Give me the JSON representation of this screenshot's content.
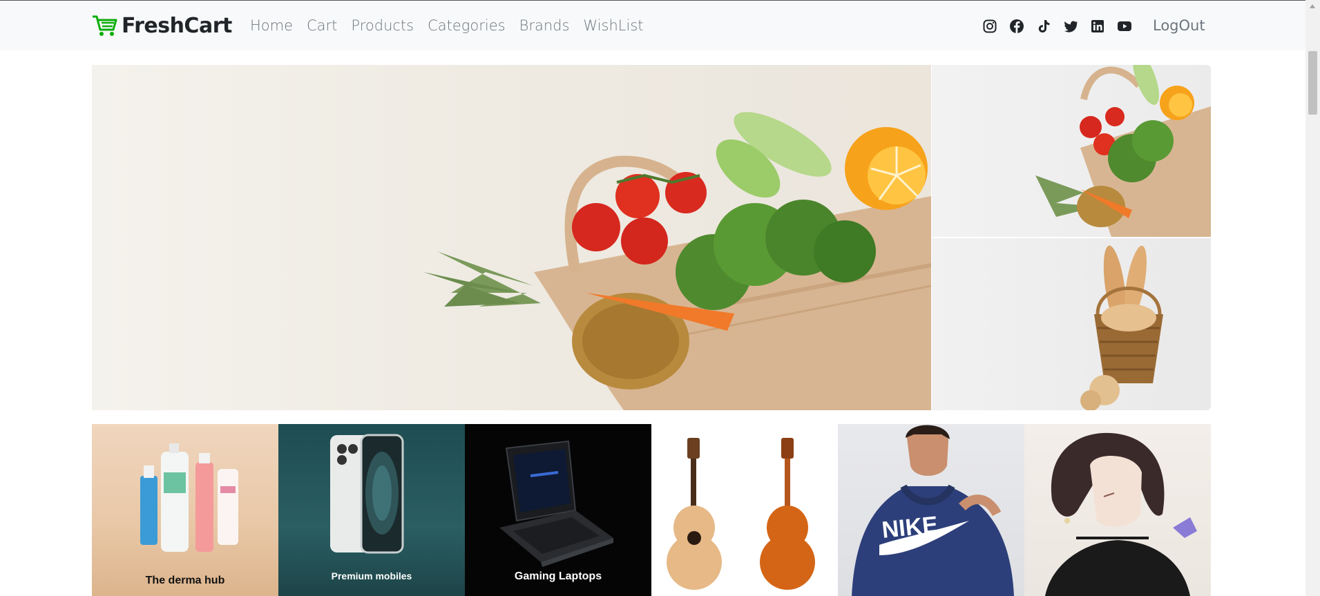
{
  "brand": {
    "name": "FreshCart",
    "icon": "shopping-cart-icon",
    "color": "#0aad0a"
  },
  "nav": {
    "links": [
      "Home",
      "Cart",
      "Products",
      "Categories",
      "Brands",
      "WishList"
    ],
    "socials": [
      "instagram-icon",
      "facebook-icon",
      "tiktok-icon",
      "twitter-icon",
      "linkedin-icon",
      "youtube-icon"
    ],
    "logout": "LogOut"
  },
  "categories": [
    {
      "label": "The derma hub"
    },
    {
      "label": "Premium mobiles"
    },
    {
      "label": "Gaming Laptops"
    },
    {
      "label": ""
    },
    {
      "label": ""
    },
    {
      "label": ""
    }
  ]
}
